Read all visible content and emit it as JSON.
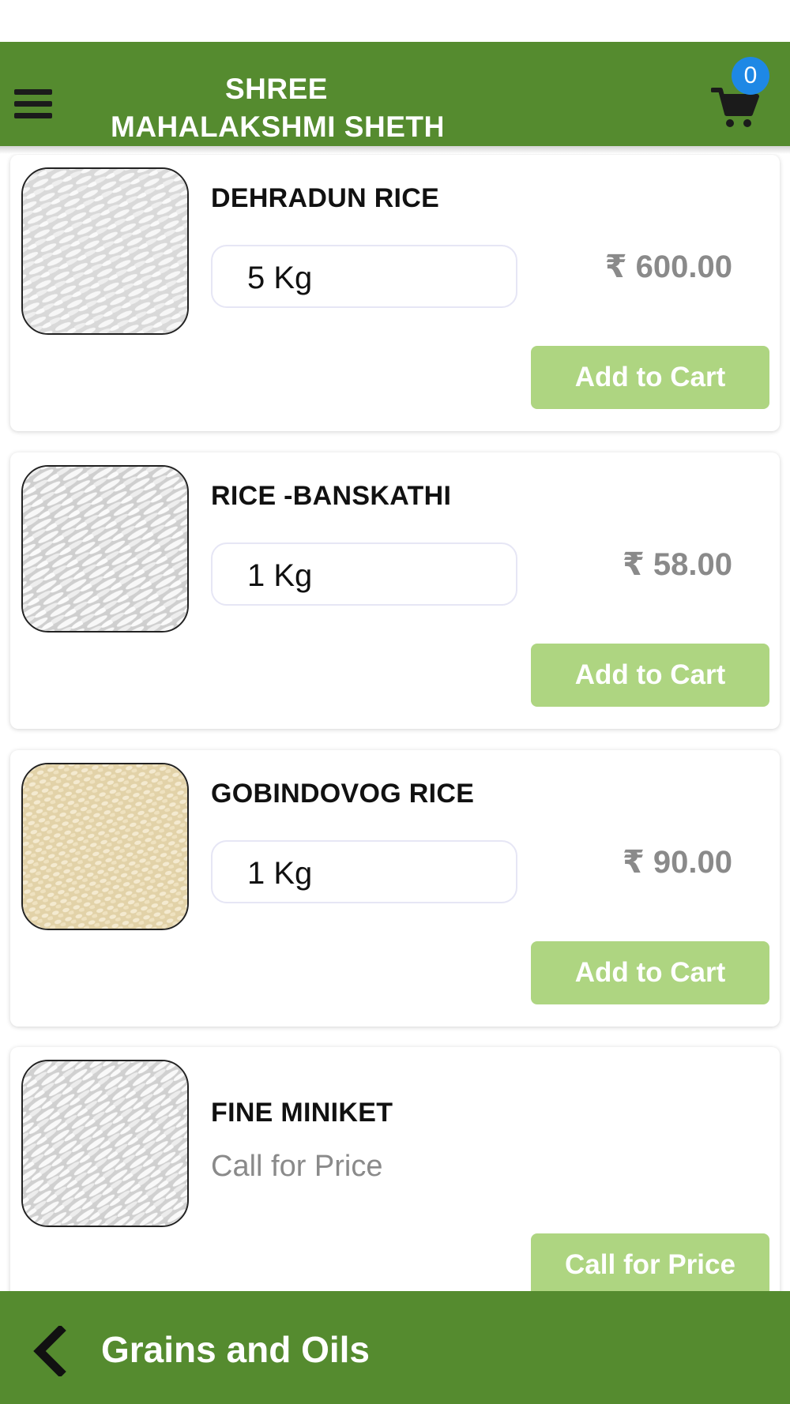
{
  "header": {
    "brand_line1": "SHREE",
    "brand_line2": "MAHALAKSHMI SHETH",
    "cart_count": "0",
    "menu_icon": "hamburger-menu-icon",
    "cart_icon": "shopping-cart-icon"
  },
  "colors": {
    "header_bg": "#558b2f",
    "button_bg": "#aed581",
    "badge_bg": "#1e88e5",
    "price_text": "#8a8a8a"
  },
  "products": [
    {
      "name": "DEHRADUN RICE",
      "quantity": "5 Kg",
      "price": "₹ 600.00",
      "button": "Add to Cart"
    },
    {
      "name": "RICE -BANSKATHI",
      "quantity": "1 Kg",
      "price": "₹ 58.00",
      "button": "Add to Cart"
    },
    {
      "name": "GOBINDOVOG RICE",
      "quantity": "1 Kg",
      "price": "₹ 90.00",
      "button": "Add to Cart"
    },
    {
      "name": "FINE MINIKET",
      "price_text": "Call for Price",
      "button": "Call for Price"
    }
  ],
  "footer": {
    "title": "Grains and Oils",
    "back_icon": "chevron-left-icon"
  }
}
